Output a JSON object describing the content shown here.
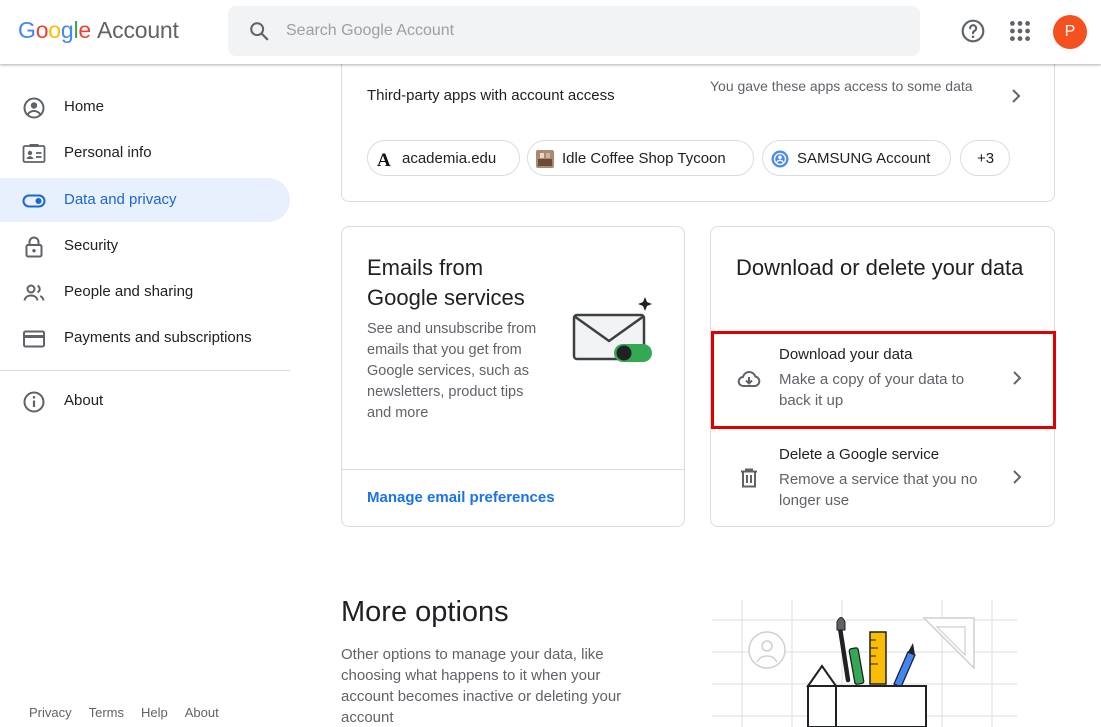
{
  "header": {
    "logo_letters": [
      "G",
      "o",
      "o",
      "g",
      "l",
      "e"
    ],
    "logo_suffix": "Account",
    "search_placeholder": "Search Google Account",
    "avatar_letter": "P",
    "icons": [
      "search-icon",
      "help-icon",
      "apps-grid-icon"
    ]
  },
  "sidebar": {
    "items": [
      {
        "label": "Home",
        "icon": "home-icon"
      },
      {
        "label": "Personal info",
        "icon": "id-card-icon"
      },
      {
        "label": "Data and privacy",
        "icon": "toggle-icon",
        "active": true
      },
      {
        "label": "Security",
        "icon": "lock-icon"
      },
      {
        "label": "People and sharing",
        "icon": "people-icon"
      },
      {
        "label": "Payments and subscriptions",
        "icon": "credit-card-icon"
      }
    ],
    "about": {
      "label": "About",
      "icon": "info-icon"
    },
    "footer": [
      "Privacy",
      "Terms",
      "Help",
      "About"
    ]
  },
  "third_party": {
    "label": "Third-party apps with account access",
    "description": "You gave these apps access to some data",
    "chips": [
      {
        "label": "academia.edu",
        "icon": "academia-logo-icon"
      },
      {
        "label": "Idle Coffee Shop Tycoon",
        "icon": "coffee-shop-app-icon"
      },
      {
        "label": "SAMSUNG Account",
        "icon": "samsung-account-icon"
      },
      {
        "label": "+3"
      }
    ]
  },
  "emails_card": {
    "title": "Emails from Google services",
    "description": "See and unsubscribe from emails that you get from Google services, such as newsletters, product tips and more",
    "link": "Manage email preferences"
  },
  "download_card": {
    "title": "Download or delete your data",
    "rows": [
      {
        "title": "Download your data",
        "description": "Make a copy of your data to back it up",
        "icon": "cloud-download-icon"
      },
      {
        "title": "Delete a Google service",
        "description": "Remove a service that you no longer use",
        "icon": "trash-icon"
      }
    ]
  },
  "more_options": {
    "title": "More options",
    "description": "Other options to manage your data, like choosing what happens to it when your account becomes inactive or deleting your account"
  },
  "colors": {
    "accent": "#1a73e8",
    "active_nav_bg": "#e8f0fe",
    "highlight_border": "#e00000",
    "avatar_bg": "#f4511e"
  }
}
